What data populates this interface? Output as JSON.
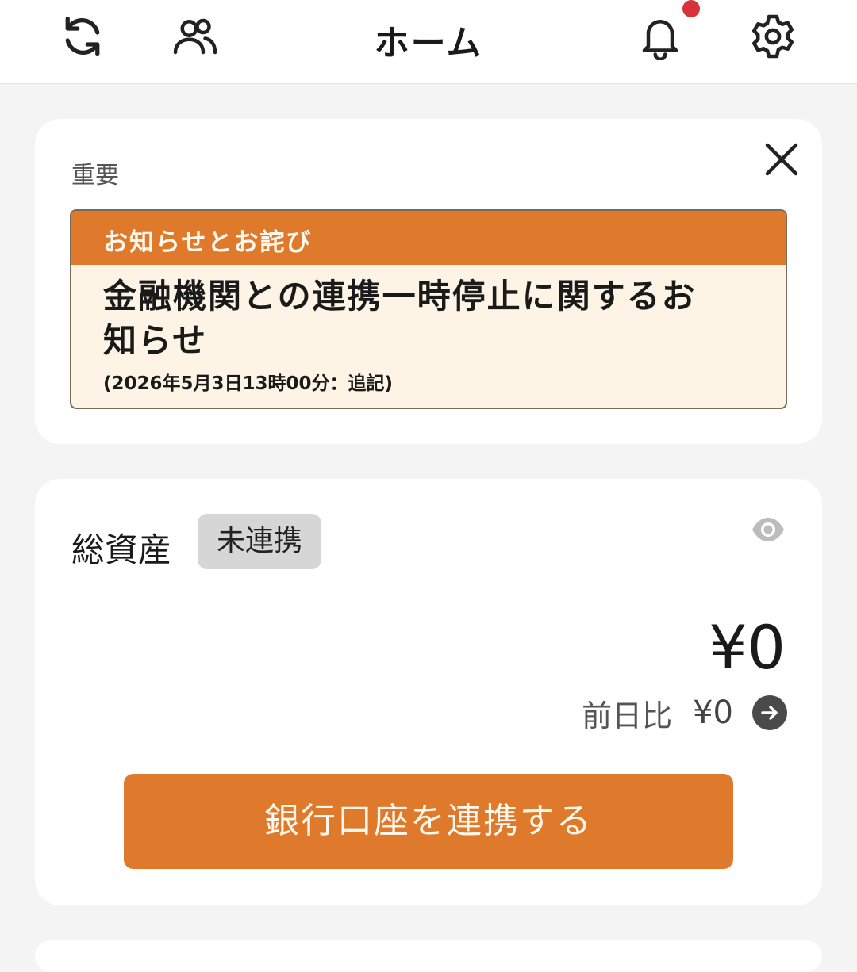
{
  "header": {
    "title": "ホーム",
    "icons": {
      "refresh": "refresh-icon",
      "users": "users-icon",
      "notifications": "bell-icon",
      "settings": "gear-icon"
    },
    "notification_dot_color": "#d8323a"
  },
  "important_card": {
    "label": "重要",
    "notice": {
      "header": "お知らせとお詫び",
      "title": "金融機関との連携一時停止に関するお知らせ",
      "date": "(2026年5月3日13時00分：追記)"
    },
    "accent_color": "#df7a2c"
  },
  "assets_card": {
    "label": "総資産",
    "status": "未連携",
    "amount": "¥0",
    "diff_label": "前日比",
    "diff_value": "¥0",
    "button_label": "銀行口座を連携する"
  }
}
